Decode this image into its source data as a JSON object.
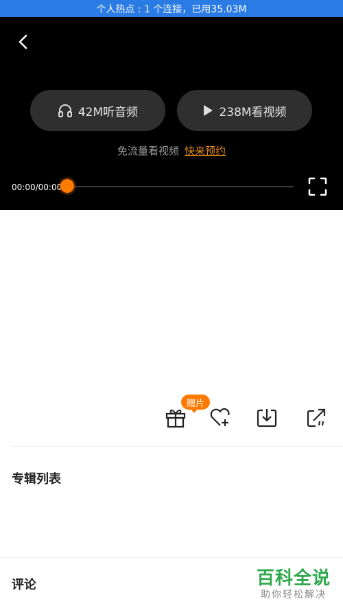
{
  "status_bar": {
    "text": "个人热点 : 1 个连接，已用35.03M"
  },
  "player": {
    "audio_label": "42M听音频",
    "video_label": "238M看视频",
    "free_text": "免流量看视频",
    "reserve_link": "快来预约",
    "time_text": "00:00/00:00",
    "progress": 0
  },
  "actions": {
    "gift_badge": "赠片"
  },
  "sections": {
    "album_list": "专辑列表",
    "comments": "评论"
  },
  "watermark": {
    "main": "百科全说",
    "sub": "助你轻松解决"
  },
  "colors": {
    "status_bar": "#2b7be5",
    "accent": "#ff7a00",
    "link": "#e58a1f",
    "watermark": "#2ea84b"
  }
}
